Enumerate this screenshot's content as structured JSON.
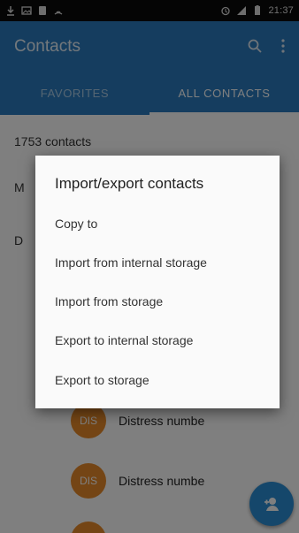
{
  "status_bar": {
    "time": "21:37",
    "left_icons": [
      "download-icon",
      "image-icon",
      "notification-icon",
      "signal-icon"
    ],
    "right_icons": [
      "alarm-icon",
      "signal-bars-icon",
      "battery-icon"
    ]
  },
  "app_bar": {
    "title": "Contacts",
    "background": "#2a7bbf",
    "tabs": [
      {
        "label": "FAVORITES",
        "active": false
      },
      {
        "label": "ALL CONTACTS",
        "active": true
      }
    ]
  },
  "list": {
    "count_label": "1753 contacts",
    "side_letters": [
      "M",
      "D"
    ],
    "contacts": [
      {
        "avatar_text": "DIS",
        "name": "Distress numbe"
      },
      {
        "avatar_text": "DIS",
        "name": "Distress numbe"
      }
    ],
    "avatar_color": "#e88b2a"
  },
  "dialog": {
    "title": "Import/export contacts",
    "items": [
      "Copy to",
      "Import from internal storage",
      "Import from storage",
      "Export to internal storage",
      "Export to storage"
    ]
  },
  "fab": {
    "icon": "add-contact-icon",
    "color": "#2a8fd6"
  }
}
